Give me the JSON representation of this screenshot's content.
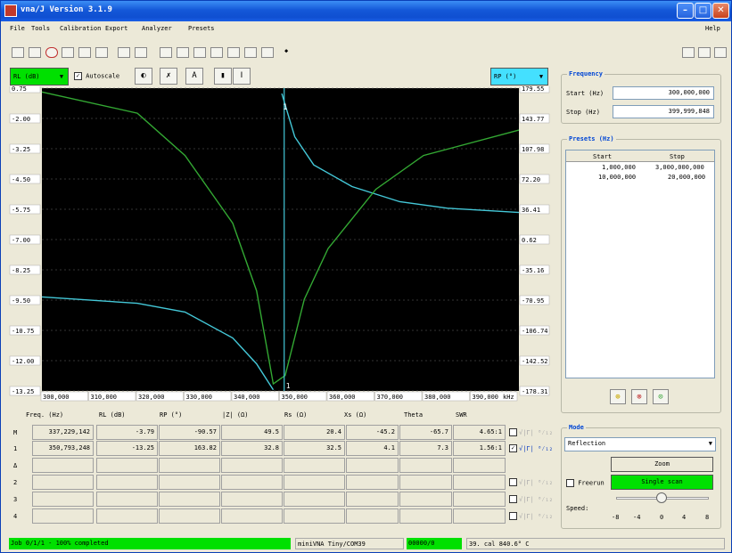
{
  "title": "vna/J Version 3.1.9",
  "menu": [
    "File",
    "Tools",
    "Calibration",
    "Export",
    "Analyzer",
    "Presets",
    "Help"
  ],
  "chart_controls": {
    "left_trace": "RL (dB)",
    "autoscale_label": "Autoscale",
    "autoscale_checked": true,
    "right_trace": "RP (°)"
  },
  "chart_data": {
    "type": "line",
    "x_ticks": [
      "300,000",
      "310,000",
      "320,000",
      "330,000",
      "340,000",
      "350,000",
      "360,000",
      "370,000",
      "380,000",
      "390,000"
    ],
    "x_unit": "kHz",
    "xlim": [
      300000,
      400000
    ],
    "y_left_ticks": [
      "0.75",
      "-2.00",
      "-3.25",
      "-4.50",
      "-5.75",
      "-7.00",
      "-8.25",
      "-9.50",
      "-10.75",
      "-12.00",
      "-13.25"
    ],
    "y_right_ticks": [
      "179.55",
      "143.77",
      "107.98",
      "72.20",
      "36.41",
      "0.62",
      "-35.16",
      "-70.95",
      "-106.74",
      "-142.52",
      "-178.31"
    ],
    "ylim_left": [
      -13.25,
      0.75
    ],
    "ylim_right": [
      -178.31,
      179.55
    ],
    "series": [
      {
        "axis": "left",
        "color": "#44c8d8",
        "points": [
          [
            300000,
            -8.9
          ],
          [
            320000,
            -9.2
          ],
          [
            330000,
            -9.6
          ],
          [
            340000,
            -10.8
          ],
          [
            345000,
            -12.0
          ],
          [
            348500,
            -13.2
          ]
        ]
      },
      {
        "axis": "left",
        "color": "#44c8d8",
        "points": [
          [
            350300,
            0.5
          ],
          [
            353000,
            -1.5
          ],
          [
            357000,
            -2.8
          ],
          [
            365000,
            -3.8
          ],
          [
            375000,
            -4.5
          ],
          [
            385000,
            -4.8
          ],
          [
            400000,
            -5.0
          ]
        ]
      },
      {
        "axis": "right",
        "color": "#33a833",
        "points": [
          [
            300000,
            175
          ],
          [
            320000,
            150
          ],
          [
            330000,
            100
          ],
          [
            340000,
            20
          ],
          [
            345000,
            -60
          ],
          [
            348500,
            -170
          ],
          [
            351000,
            -160
          ],
          [
            355000,
            -70
          ],
          [
            360000,
            -10
          ],
          [
            370000,
            60
          ],
          [
            380000,
            100
          ],
          [
            400000,
            130
          ]
        ]
      }
    ],
    "markers": [
      {
        "label": "1",
        "x": 350793
      }
    ],
    "cursor_label": "1"
  },
  "frequency": {
    "title": "Frequency",
    "start_label": "Start (Hz)",
    "start_value": "300,000,000",
    "stop_label": "Stop (Hz)",
    "stop_value": "399,999,848"
  },
  "presets": {
    "title": "Presets (Hz)",
    "columns": [
      "Start",
      "Stop"
    ],
    "rows": [
      [
        "1,000,000",
        "3,000,000,000"
      ],
      [
        "10,000,000",
        "20,000,000"
      ]
    ]
  },
  "mode": {
    "title": "Mode",
    "selected": "Reflection",
    "zoom_label": "Zoom",
    "freerun_label": "Freerun",
    "single_scan_label": "Single scan",
    "speed_label": "Speed:",
    "speed_ticks": [
      "-8",
      "-4",
      "0",
      "4",
      "8"
    ]
  },
  "marker_table": {
    "headers": [
      "Freq. (Hz)",
      "RL (dB)",
      "RP (°)",
      "|Z| (Ω)",
      "Rs (Ω)",
      "Xs (Ω)",
      "Theta",
      "SWR"
    ],
    "rows": [
      {
        "label": "M",
        "values": [
          "337,229,142",
          "-3.79",
          "-90.57",
          "49.5",
          "20.4",
          "-45.2",
          "-65.7",
          "4.65:1"
        ]
      },
      {
        "label": "1",
        "values": [
          "350,793,248",
          "-13.25",
          "163.82",
          "32.8",
          "32.5",
          "4.1",
          "7.3",
          "1.56:1"
        ]
      },
      {
        "label": "Δ",
        "values": [
          "",
          "",
          "",
          "",
          "",
          "",
          "",
          ""
        ]
      },
      {
        "label": "2",
        "values": [
          "",
          "",
          "",
          "",
          "",
          "",
          "",
          ""
        ]
      },
      {
        "label": "3",
        "values": [
          "",
          "",
          "",
          "",
          "",
          "",
          "",
          ""
        ]
      },
      {
        "label": "4",
        "values": [
          "",
          "",
          "",
          "",
          "",
          "",
          "",
          ""
        ]
      }
    ],
    "smith_label": "√|Γ| ⁰⁄₁₂"
  },
  "status": {
    "job": "Job 0/1/1 - 100% completed",
    "device": "miniVNA Tiny/COM39",
    "code": "00000/0",
    "temp": "39. cal 840.6° C"
  }
}
